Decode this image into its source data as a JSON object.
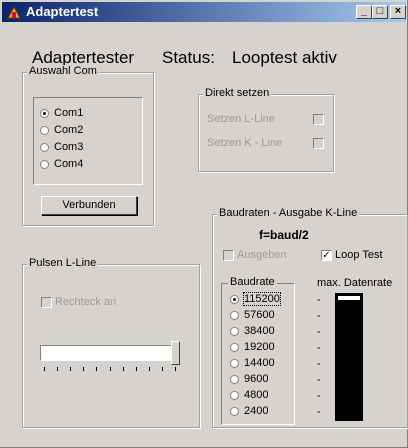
{
  "window": {
    "title": "Adaptertest"
  },
  "header": {
    "app_name": "Adaptertester",
    "status_label": "Status:",
    "status_value": "Looptest aktiv"
  },
  "com_group": {
    "label": "Auswahl Com",
    "options": [
      "Com1",
      "Com2",
      "Com3",
      "Com4"
    ],
    "selected": "Com1",
    "connect_button": "Verbunden"
  },
  "direkt_group": {
    "label": "Direkt setzen",
    "l_line": "Setzen L-Line",
    "k_line": "Setzen K - Line"
  },
  "baud_group": {
    "label": "Baudraten - Ausgabe K-Line",
    "formula": "f=baud/2",
    "ausgeben": "Ausgeben",
    "loop_test": "Loop Test",
    "loop_test_checked": true,
    "baudrate_label": "Baudrate",
    "rates": [
      "115200",
      "57600",
      "38400",
      "19200",
      "14400",
      "9600",
      "4800",
      "2400"
    ],
    "selected_rate": "115200",
    "dashes": [
      "-",
      "-",
      "-",
      "-",
      "-",
      "-",
      "-",
      "-"
    ],
    "max_rate_label": "max. Datenrate",
    "max_rate_level": 0.03
  },
  "pulsen_group": {
    "label": "Pulsen L-Line",
    "rechteck": "Rechteck an",
    "slider_level": 1.0
  },
  "colors": {
    "title_start": "#0a246a",
    "title_end": "#a6caf0",
    "face": "#d6d3ce"
  }
}
